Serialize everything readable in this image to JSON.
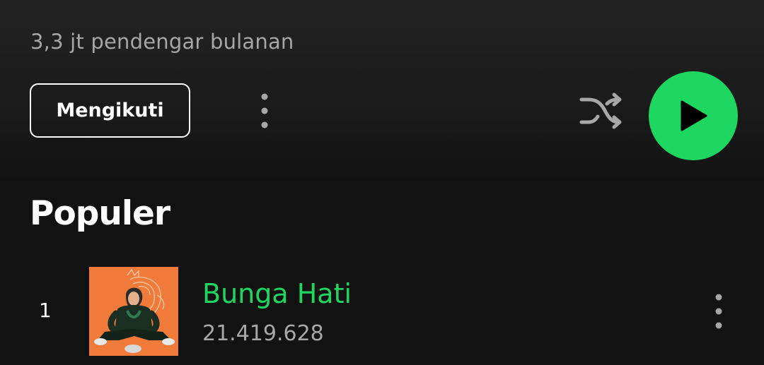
{
  "artist": {
    "monthly_listeners": "3,3 jt pendengar bulanan"
  },
  "actions": {
    "follow_label": "Mengikuti",
    "more_icon": "more-vertical-icon",
    "shuffle_icon": "shuffle-icon",
    "play_icon": "play-icon"
  },
  "popular": {
    "title": "Populer",
    "tracks": [
      {
        "index": "1",
        "title": "Bunga Hati",
        "plays": "21.419.628",
        "cover_icon": "album-cover-image",
        "more_icon": "more-vertical-icon"
      }
    ]
  },
  "colors": {
    "accent": "#1ed760",
    "background": "#121212",
    "secondary_text": "#a7a7a7",
    "cover_background": "#ef7a3a"
  }
}
